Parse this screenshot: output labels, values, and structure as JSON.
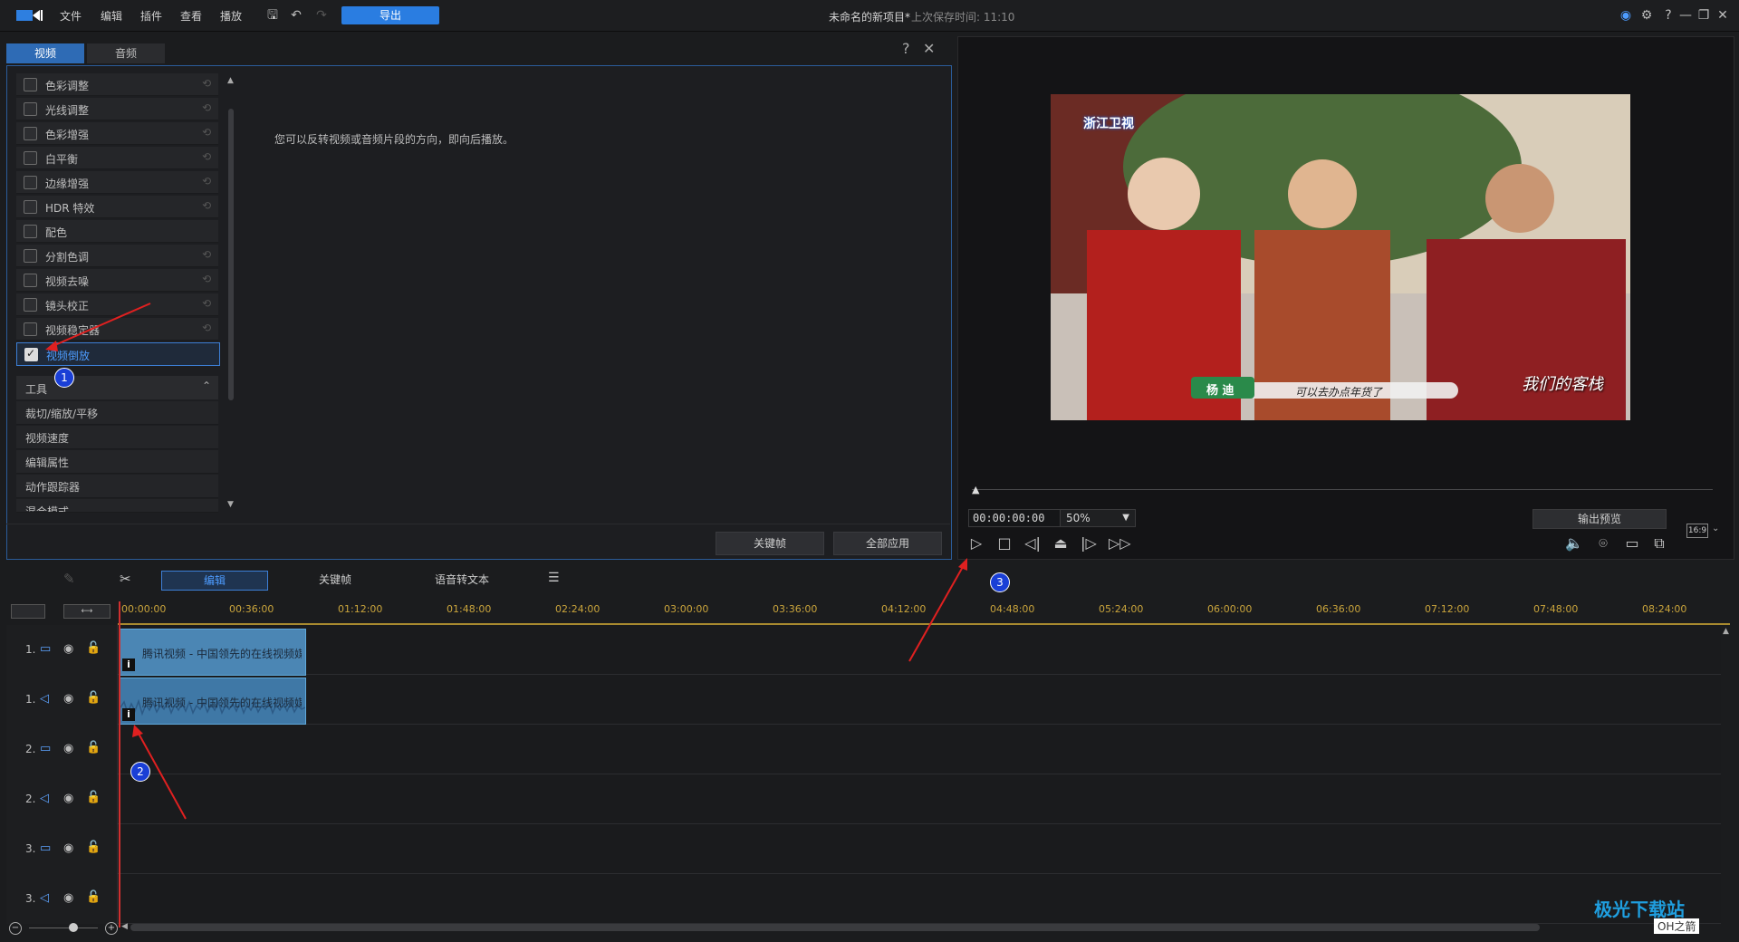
{
  "menu": [
    "文件",
    "编辑",
    "插件",
    "查看",
    "播放"
  ],
  "toolbar": {
    "export_label": "导出"
  },
  "project": {
    "title": "未命名的新项目*",
    "save_status": "上次保存时间: 11:10"
  },
  "panel": {
    "tabs": [
      "视频",
      "音频"
    ],
    "effects": [
      {
        "label": "色彩调整",
        "checked": false
      },
      {
        "label": "光线调整",
        "checked": false
      },
      {
        "label": "色彩增强",
        "checked": false
      },
      {
        "label": "白平衡",
        "checked": false
      },
      {
        "label": "边缘增强",
        "checked": false
      },
      {
        "label": "HDR 特效",
        "checked": false
      },
      {
        "label": "配色",
        "checked": false
      },
      {
        "label": "分割色调",
        "checked": false
      },
      {
        "label": "视频去噪",
        "checked": false
      },
      {
        "label": "镜头校正",
        "checked": false
      },
      {
        "label": "视频稳定器",
        "checked": false
      },
      {
        "label": "视频倒放",
        "checked": true
      }
    ],
    "tools_header": "工具",
    "tools": [
      "裁切/缩放/平移",
      "视频速度",
      "编辑属性",
      "动作跟踪器",
      "混合模式"
    ],
    "description": "您可以反转视频或音频片段的方向，即向后播放。",
    "keyframe_button": "关键帧",
    "apply_all_button": "全部应用"
  },
  "preview": {
    "timecode": "00:00:00:00",
    "zoom": "50%",
    "output_preview": "输出预览",
    "aspect": "16:9",
    "overlay_logo": "浙江卫视",
    "caption_name": "杨 迪",
    "caption_text": "可以去办点年货了",
    "show_logo": "我们的客栈"
  },
  "timeline": {
    "tabs": [
      "编辑",
      "关键帧",
      "语音转文本"
    ],
    "ruler": [
      "00:00:00",
      "00:36:00",
      "01:12:00",
      "01:48:00",
      "02:24:00",
      "03:00:00",
      "03:36:00",
      "04:12:00",
      "04:48:00",
      "05:24:00",
      "06:00:00",
      "06:36:00",
      "07:12:00",
      "07:48:00",
      "08:24:00"
    ],
    "tracks": [
      "1.",
      "1.",
      "2.",
      "2.",
      "3.",
      "3."
    ],
    "clip_title": "腾讯视频 - 中国领先的在线视频媒"
  },
  "annotations": [
    "1",
    "2",
    "3"
  ],
  "watermark": {
    "main": "极光下载站",
    "sub": "OH之箭"
  }
}
